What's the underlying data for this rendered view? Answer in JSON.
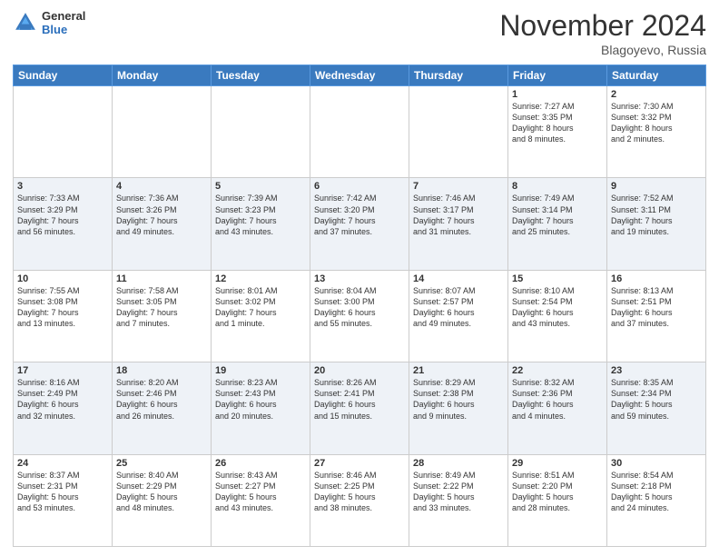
{
  "header": {
    "logo_general": "General",
    "logo_blue": "Blue",
    "month_title": "November 2024",
    "location": "Blagoyevo, Russia"
  },
  "weekdays": [
    "Sunday",
    "Monday",
    "Tuesday",
    "Wednesday",
    "Thursday",
    "Friday",
    "Saturday"
  ],
  "rows": [
    {
      "shaded": false,
      "cells": [
        {
          "day": "",
          "info": ""
        },
        {
          "day": "",
          "info": ""
        },
        {
          "day": "",
          "info": ""
        },
        {
          "day": "",
          "info": ""
        },
        {
          "day": "",
          "info": ""
        },
        {
          "day": "1",
          "info": "Sunrise: 7:27 AM\nSunset: 3:35 PM\nDaylight: 8 hours\nand 8 minutes."
        },
        {
          "day": "2",
          "info": "Sunrise: 7:30 AM\nSunset: 3:32 PM\nDaylight: 8 hours\nand 2 minutes."
        }
      ]
    },
    {
      "shaded": true,
      "cells": [
        {
          "day": "3",
          "info": "Sunrise: 7:33 AM\nSunset: 3:29 PM\nDaylight: 7 hours\nand 56 minutes."
        },
        {
          "day": "4",
          "info": "Sunrise: 7:36 AM\nSunset: 3:26 PM\nDaylight: 7 hours\nand 49 minutes."
        },
        {
          "day": "5",
          "info": "Sunrise: 7:39 AM\nSunset: 3:23 PM\nDaylight: 7 hours\nand 43 minutes."
        },
        {
          "day": "6",
          "info": "Sunrise: 7:42 AM\nSunset: 3:20 PM\nDaylight: 7 hours\nand 37 minutes."
        },
        {
          "day": "7",
          "info": "Sunrise: 7:46 AM\nSunset: 3:17 PM\nDaylight: 7 hours\nand 31 minutes."
        },
        {
          "day": "8",
          "info": "Sunrise: 7:49 AM\nSunset: 3:14 PM\nDaylight: 7 hours\nand 25 minutes."
        },
        {
          "day": "9",
          "info": "Sunrise: 7:52 AM\nSunset: 3:11 PM\nDaylight: 7 hours\nand 19 minutes."
        }
      ]
    },
    {
      "shaded": false,
      "cells": [
        {
          "day": "10",
          "info": "Sunrise: 7:55 AM\nSunset: 3:08 PM\nDaylight: 7 hours\nand 13 minutes."
        },
        {
          "day": "11",
          "info": "Sunrise: 7:58 AM\nSunset: 3:05 PM\nDaylight: 7 hours\nand 7 minutes."
        },
        {
          "day": "12",
          "info": "Sunrise: 8:01 AM\nSunset: 3:02 PM\nDaylight: 7 hours\nand 1 minute."
        },
        {
          "day": "13",
          "info": "Sunrise: 8:04 AM\nSunset: 3:00 PM\nDaylight: 6 hours\nand 55 minutes."
        },
        {
          "day": "14",
          "info": "Sunrise: 8:07 AM\nSunset: 2:57 PM\nDaylight: 6 hours\nand 49 minutes."
        },
        {
          "day": "15",
          "info": "Sunrise: 8:10 AM\nSunset: 2:54 PM\nDaylight: 6 hours\nand 43 minutes."
        },
        {
          "day": "16",
          "info": "Sunrise: 8:13 AM\nSunset: 2:51 PM\nDaylight: 6 hours\nand 37 minutes."
        }
      ]
    },
    {
      "shaded": true,
      "cells": [
        {
          "day": "17",
          "info": "Sunrise: 8:16 AM\nSunset: 2:49 PM\nDaylight: 6 hours\nand 32 minutes."
        },
        {
          "day": "18",
          "info": "Sunrise: 8:20 AM\nSunset: 2:46 PM\nDaylight: 6 hours\nand 26 minutes."
        },
        {
          "day": "19",
          "info": "Sunrise: 8:23 AM\nSunset: 2:43 PM\nDaylight: 6 hours\nand 20 minutes."
        },
        {
          "day": "20",
          "info": "Sunrise: 8:26 AM\nSunset: 2:41 PM\nDaylight: 6 hours\nand 15 minutes."
        },
        {
          "day": "21",
          "info": "Sunrise: 8:29 AM\nSunset: 2:38 PM\nDaylight: 6 hours\nand 9 minutes."
        },
        {
          "day": "22",
          "info": "Sunrise: 8:32 AM\nSunset: 2:36 PM\nDaylight: 6 hours\nand 4 minutes."
        },
        {
          "day": "23",
          "info": "Sunrise: 8:35 AM\nSunset: 2:34 PM\nDaylight: 5 hours\nand 59 minutes."
        }
      ]
    },
    {
      "shaded": false,
      "cells": [
        {
          "day": "24",
          "info": "Sunrise: 8:37 AM\nSunset: 2:31 PM\nDaylight: 5 hours\nand 53 minutes."
        },
        {
          "day": "25",
          "info": "Sunrise: 8:40 AM\nSunset: 2:29 PM\nDaylight: 5 hours\nand 48 minutes."
        },
        {
          "day": "26",
          "info": "Sunrise: 8:43 AM\nSunset: 2:27 PM\nDaylight: 5 hours\nand 43 minutes."
        },
        {
          "day": "27",
          "info": "Sunrise: 8:46 AM\nSunset: 2:25 PM\nDaylight: 5 hours\nand 38 minutes."
        },
        {
          "day": "28",
          "info": "Sunrise: 8:49 AM\nSunset: 2:22 PM\nDaylight: 5 hours\nand 33 minutes."
        },
        {
          "day": "29",
          "info": "Sunrise: 8:51 AM\nSunset: 2:20 PM\nDaylight: 5 hours\nand 28 minutes."
        },
        {
          "day": "30",
          "info": "Sunrise: 8:54 AM\nSunset: 2:18 PM\nDaylight: 5 hours\nand 24 minutes."
        }
      ]
    }
  ]
}
